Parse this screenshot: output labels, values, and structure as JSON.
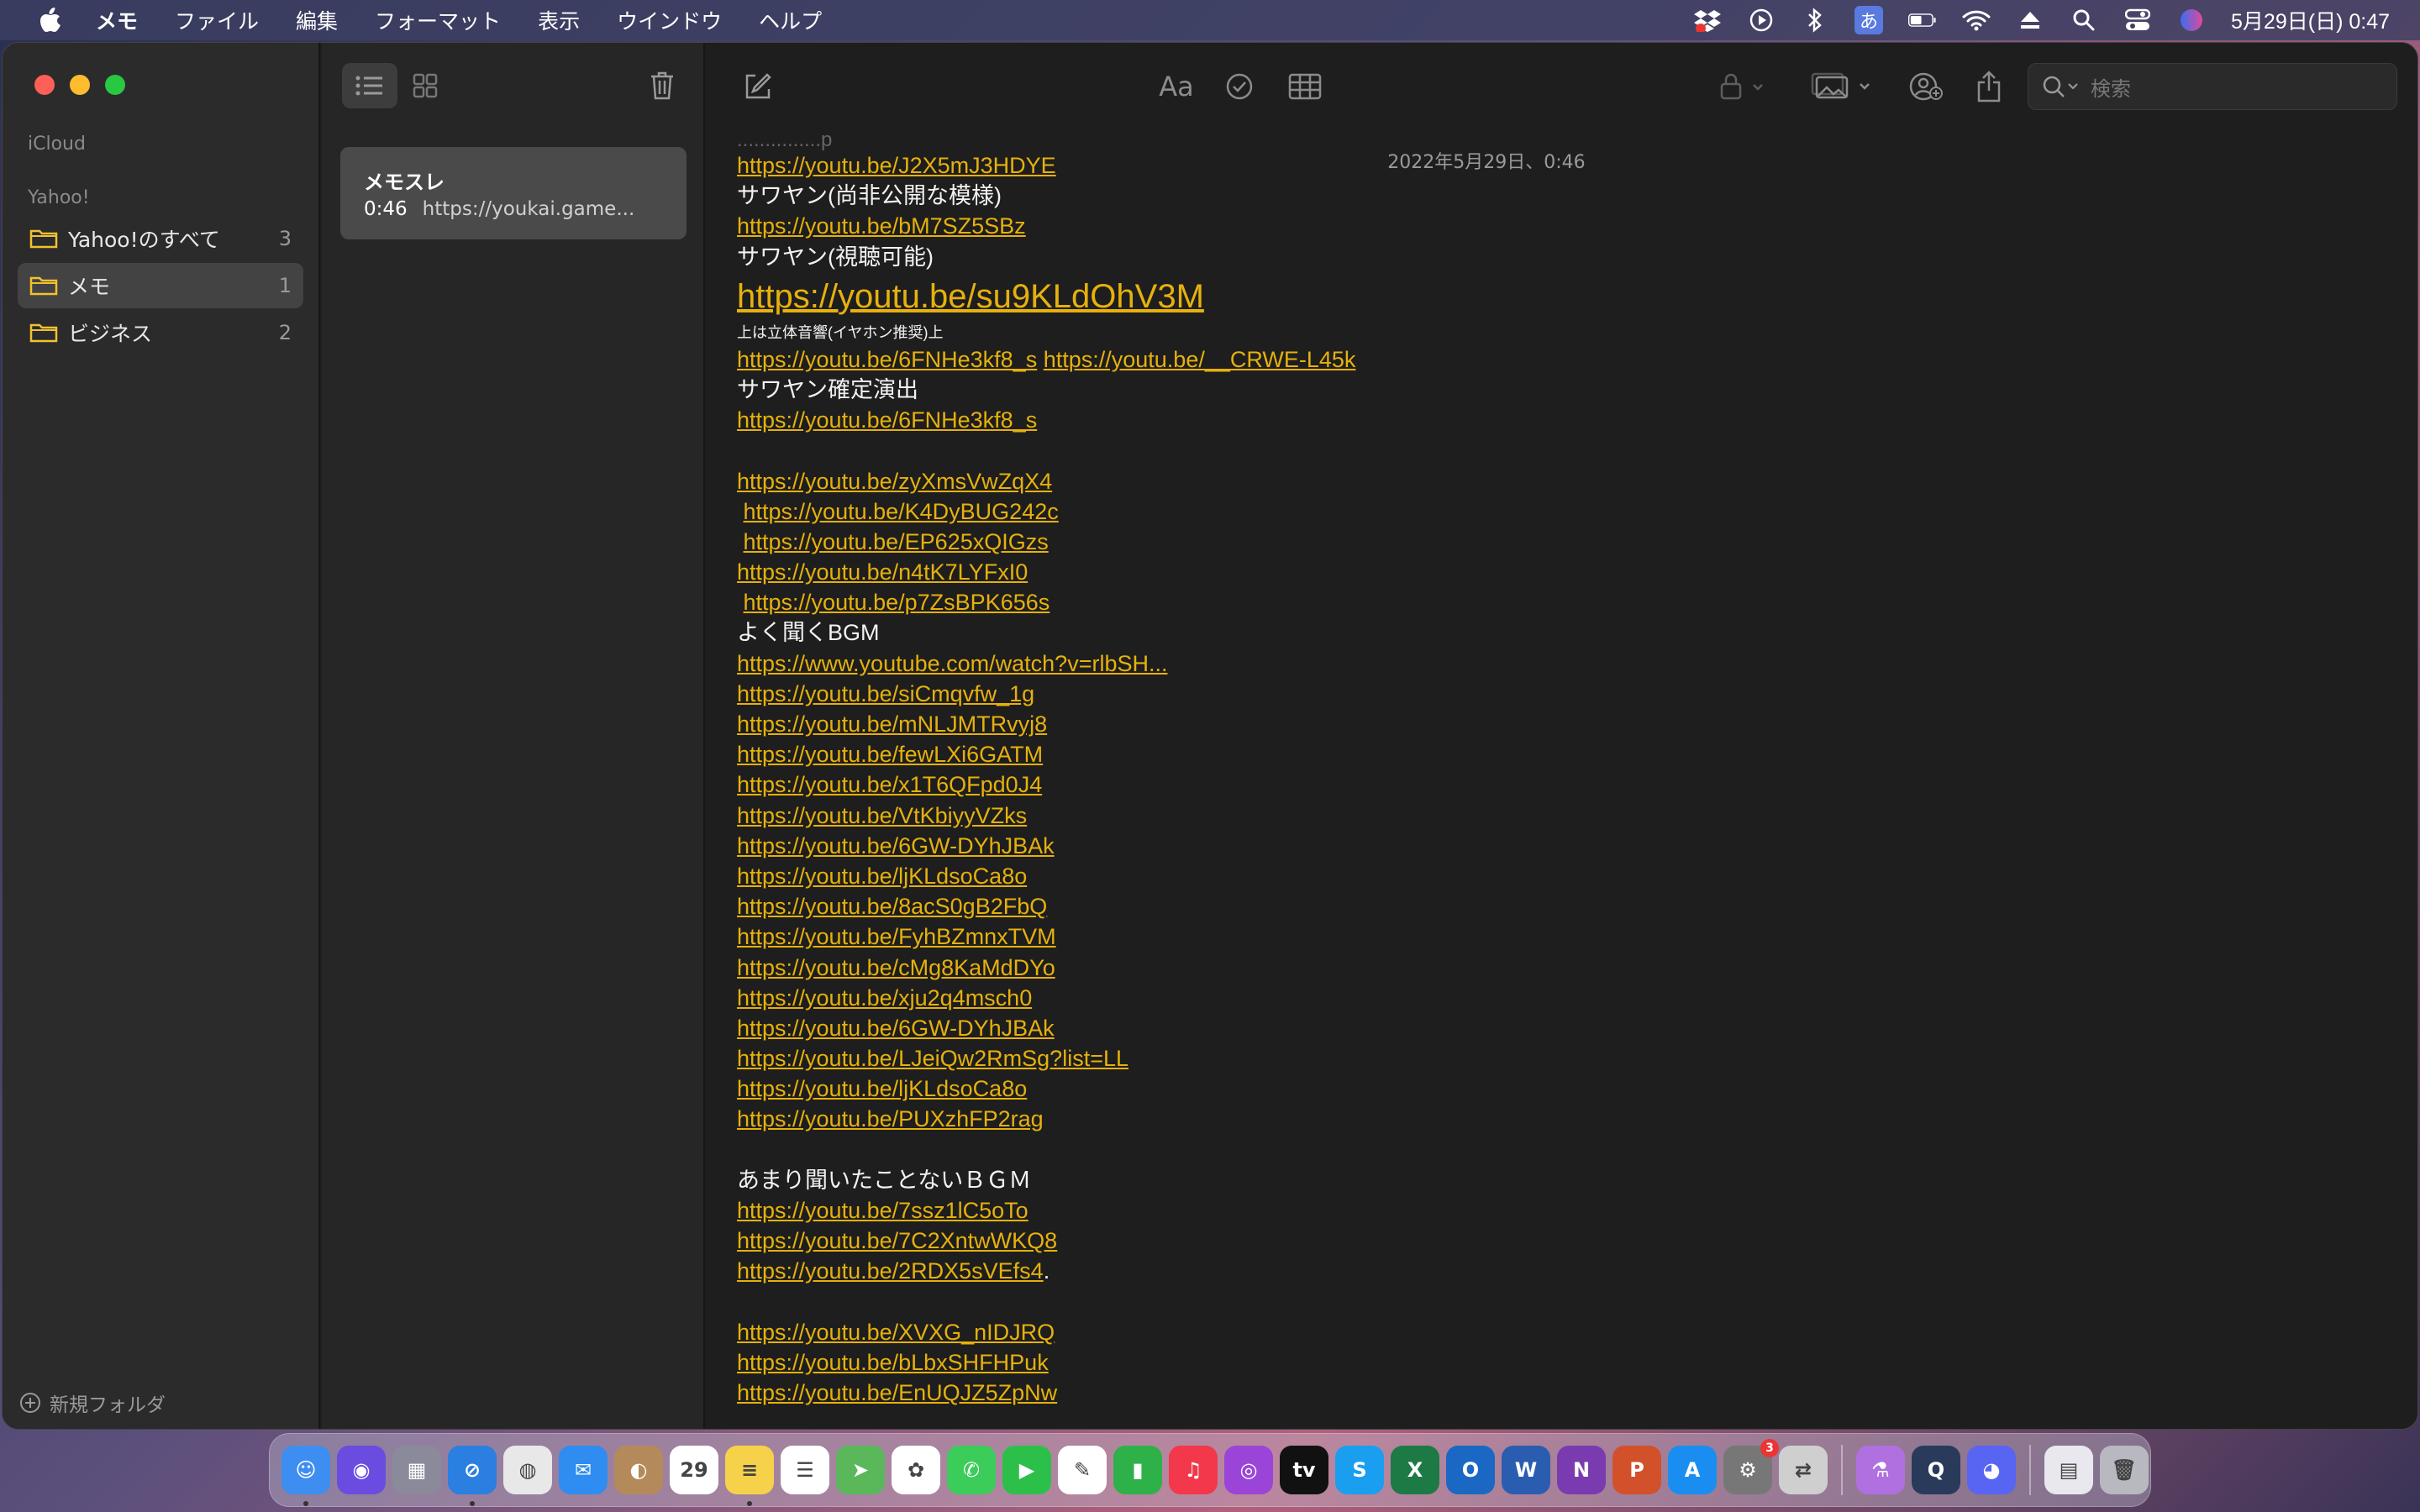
{
  "menubar": {
    "app_name": "メモ",
    "menus": [
      "ファイル",
      "編集",
      "フォーマット",
      "表示",
      "ウインドウ",
      "ヘルプ"
    ],
    "clock": "5月29日(日) 0:47",
    "input_method": "あ"
  },
  "sidebar": {
    "icloud_label": "iCloud",
    "yahoo_label": "Yahoo!",
    "folders": [
      {
        "label": "Yahoo!のすべて",
        "count": "3"
      },
      {
        "label": "メモ",
        "count": "1"
      },
      {
        "label": "ビジネス",
        "count": "2"
      }
    ],
    "new_folder_label": "新規フォルダ"
  },
  "note_list": {
    "notes": [
      {
        "title": "メモスレ",
        "time": "0:46",
        "preview": "https://youkai.game..."
      }
    ]
  },
  "editor": {
    "search_placeholder": "検索",
    "format_label": "Aa",
    "date": "2022年5月29日、0:46",
    "lines": [
      {
        "type": "cut",
        "parts": [
          {
            "text": "...............p"
          }
        ]
      },
      {
        "type": "normal",
        "parts": [
          {
            "text": "https://youtu.be/J2X5mJ3HDYE",
            "link": true
          }
        ]
      },
      {
        "type": "normal",
        "parts": [
          {
            "text": "サワヤン(尚非公開な模様)"
          }
        ]
      },
      {
        "type": "normal",
        "parts": [
          {
            "text": "https://youtu.be/bM7SZ5SBz",
            "link": true
          }
        ]
      },
      {
        "type": "normal",
        "parts": [
          {
            "text": "サワヤン(視聴可能)"
          }
        ]
      },
      {
        "type": "big",
        "parts": [
          {
            "text": "https://youtu.be/su9KLdOhV3M",
            "link": true
          }
        ]
      },
      {
        "type": "small",
        "parts": [
          {
            "text": "上は立体音響(イヤホン推奨)上"
          }
        ]
      },
      {
        "type": "normal",
        "parts": [
          {
            "text": "https://youtu.be/6FNHe3kf8_s",
            "link": true
          },
          {
            "text": " "
          },
          {
            "text": "https://youtu.be/__CRWE-L45k",
            "link": true
          }
        ]
      },
      {
        "type": "normal",
        "parts": [
          {
            "text": "サワヤン確定演出"
          }
        ]
      },
      {
        "type": "normal",
        "parts": [
          {
            "text": "https://youtu.be/6FNHe3kf8_s",
            "link": true
          }
        ]
      },
      {
        "type": "normal",
        "parts": [
          {
            "text": ""
          }
        ]
      },
      {
        "type": "normal",
        "parts": [
          {
            "text": "https://youtu.be/zyXmsVwZqX4",
            "link": true
          }
        ]
      },
      {
        "type": "normal",
        "parts": [
          {
            "text": " "
          },
          {
            "text": "https://youtu.be/K4DyBUG242c",
            "link": true
          }
        ]
      },
      {
        "type": "normal",
        "parts": [
          {
            "text": " "
          },
          {
            "text": "https://youtu.be/EP625xQIGzs",
            "link": true
          }
        ]
      },
      {
        "type": "normal",
        "parts": [
          {
            "text": "https://youtu.be/n4tK7LYFxI0",
            "link": true
          }
        ]
      },
      {
        "type": "normal",
        "parts": [
          {
            "text": " "
          },
          {
            "text": "https://youtu.be/p7ZsBPK656s",
            "link": true
          }
        ]
      },
      {
        "type": "normal",
        "parts": [
          {
            "text": "よく聞くBGM"
          }
        ]
      },
      {
        "type": "normal",
        "parts": [
          {
            "text": "https://www.youtube.com/watch?v=rlbSH...",
            "link": true
          }
        ]
      },
      {
        "type": "normal",
        "parts": [
          {
            "text": "https://youtu.be/siCmqvfw_1g",
            "link": true
          }
        ]
      },
      {
        "type": "normal",
        "parts": [
          {
            "text": "https://youtu.be/mNLJMTRvyj8",
            "link": true
          }
        ]
      },
      {
        "type": "normal",
        "parts": [
          {
            "text": "https://youtu.be/fewLXi6GATM",
            "link": true
          }
        ]
      },
      {
        "type": "normal",
        "parts": [
          {
            "text": "https://youtu.be/x1T6QFpd0J4",
            "link": true
          }
        ]
      },
      {
        "type": "normal",
        "parts": [
          {
            "text": "https://youtu.be/VtKbiyyVZks",
            "link": true
          }
        ]
      },
      {
        "type": "normal",
        "parts": [
          {
            "text": "https://youtu.be/6GW-DYhJBAk",
            "link": true
          }
        ]
      },
      {
        "type": "normal",
        "parts": [
          {
            "text": "https://youtu.be/ljKLdsoCa8o",
            "link": true
          }
        ]
      },
      {
        "type": "normal",
        "parts": [
          {
            "text": "https://youtu.be/8acS0gB2FbQ",
            "link": true
          }
        ]
      },
      {
        "type": "normal",
        "parts": [
          {
            "text": "https://youtu.be/FyhBZmnxTVM",
            "link": true
          }
        ]
      },
      {
        "type": "normal",
        "parts": [
          {
            "text": "https://youtu.be/cMg8KaMdDYo",
            "link": true
          }
        ]
      },
      {
        "type": "normal",
        "parts": [
          {
            "text": "https://youtu.be/xju2q4msch0",
            "link": true
          }
        ]
      },
      {
        "type": "normal",
        "parts": [
          {
            "text": "https://youtu.be/6GW-DYhJBAk",
            "link": true
          }
        ]
      },
      {
        "type": "normal",
        "parts": [
          {
            "text": "https://youtu.be/LJeiQw2RmSg?list=LL",
            "link": true
          }
        ]
      },
      {
        "type": "normal",
        "parts": [
          {
            "text": "https://youtu.be/ljKLdsoCa8o",
            "link": true
          }
        ]
      },
      {
        "type": "normal",
        "parts": [
          {
            "text": "https://youtu.be/PUXzhFP2rag",
            "link": true
          }
        ]
      },
      {
        "type": "normal",
        "parts": [
          {
            "text": ""
          }
        ]
      },
      {
        "type": "normal",
        "parts": [
          {
            "text": "あまり聞いたことないＢＧＭ"
          }
        ]
      },
      {
        "type": "normal",
        "parts": [
          {
            "text": "https://youtu.be/7ssz1lC5oTo",
            "link": true
          }
        ]
      },
      {
        "type": "normal",
        "parts": [
          {
            "text": "https://youtu.be/7C2XntwWKQ8",
            "link": true
          }
        ]
      },
      {
        "type": "normal",
        "parts": [
          {
            "text": "https://youtu.be/2RDX5sVEfs4",
            "link": true
          },
          {
            "text": "."
          }
        ]
      },
      {
        "type": "normal",
        "parts": [
          {
            "text": ""
          }
        ]
      },
      {
        "type": "normal",
        "parts": [
          {
            "text": "https://youtu.be/XVXG_nIDJRQ",
            "link": true
          }
        ]
      },
      {
        "type": "normal",
        "parts": [
          {
            "text": "https://youtu.be/bLbxSHFHPuk",
            "link": true
          }
        ]
      },
      {
        "type": "normal",
        "parts": [
          {
            "text": "https://youtu.be/EnUQJZ5ZpNw",
            "link": true
          }
        ]
      }
    ]
  },
  "dock": {
    "apps": [
      {
        "name": "finder",
        "color": "#3d8ef0",
        "glyph": "☺",
        "running": true
      },
      {
        "name": "siri",
        "color": "#6a4ce0",
        "glyph": "◉"
      },
      {
        "name": "launchpad",
        "color": "#8a8a9a",
        "glyph": "▦"
      },
      {
        "name": "safari",
        "color": "#2a7fe0",
        "glyph": "⊘",
        "running": true
      },
      {
        "name": "chrome",
        "color": "#e8e8e8",
        "glyph": "◍"
      },
      {
        "name": "mail",
        "color": "#2f8cf0",
        "glyph": "✉"
      },
      {
        "name": "contacts",
        "color": "#b48a5a",
        "glyph": "◐"
      },
      {
        "name": "calendar",
        "color": "#ffffff",
        "glyph": "29"
      },
      {
        "name": "notes",
        "color": "#f5d24a",
        "glyph": "≡",
        "running": true
      },
      {
        "name": "reminders",
        "color": "#ffffff",
        "glyph": "☰"
      },
      {
        "name": "maps",
        "color": "#5ab85a",
        "glyph": "➤"
      },
      {
        "name": "photos",
        "color": "#ffffff",
        "glyph": "✿"
      },
      {
        "name": "messages",
        "color": "#3ccc5a",
        "glyph": "✆"
      },
      {
        "name": "facetime",
        "color": "#2cc04a",
        "glyph": "▶"
      },
      {
        "name": "freeform",
        "color": "#ffffff",
        "glyph": "✎"
      },
      {
        "name": "numbers",
        "color": "#2fb14a",
        "glyph": "▮"
      },
      {
        "name": "music",
        "color": "#f2384a",
        "glyph": "♫"
      },
      {
        "name": "podcasts",
        "color": "#9a45d8",
        "glyph": "◎"
      },
      {
        "name": "tv",
        "color": "#111111",
        "glyph": "tv"
      },
      {
        "name": "skype",
        "color": "#1a9ef0",
        "glyph": "S"
      },
      {
        "name": "excel",
        "color": "#1d7a44",
        "glyph": "X"
      },
      {
        "name": "outlook",
        "color": "#1a68c4",
        "glyph": "O"
      },
      {
        "name": "word",
        "color": "#2a5db0",
        "glyph": "W"
      },
      {
        "name": "onenote",
        "color": "#7a3bb0",
        "glyph": "N"
      },
      {
        "name": "powerpoint",
        "color": "#d2502a",
        "glyph": "P"
      },
      {
        "name": "app-store",
        "color": "#1a8ef0",
        "glyph": "A"
      },
      {
        "name": "system-preferences",
        "color": "#777777",
        "glyph": "⚙",
        "badge": "3"
      },
      {
        "name": "migration-assistant",
        "color": "#cfcfcf",
        "glyph": "⇄"
      },
      {
        "sep": true
      },
      {
        "name": "potion-app",
        "color": "#b070e0",
        "glyph": "⚗"
      },
      {
        "name": "quicktime",
        "color": "#2a3a5a",
        "glyph": "Q"
      },
      {
        "name": "discord",
        "color": "#5865f2",
        "glyph": "◕"
      },
      {
        "sep": true
      },
      {
        "name": "document",
        "color": "#e8e8ee",
        "glyph": "▤"
      },
      {
        "name": "trash",
        "color": "#b8b8c0",
        "glyph": "🗑"
      }
    ]
  }
}
